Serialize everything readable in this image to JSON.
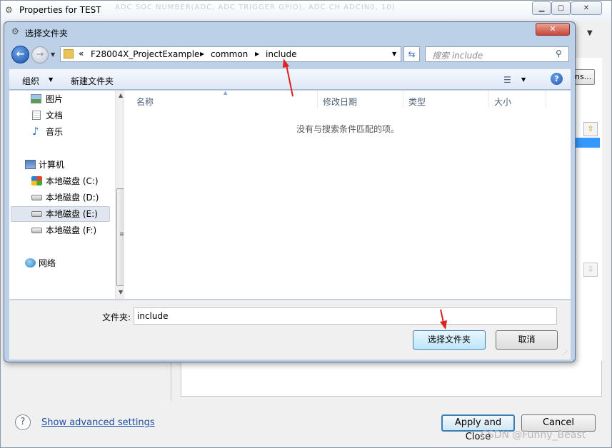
{
  "properties_window": {
    "title": "Properties for TEST",
    "faint_background_text": "ADC  SOC  NUMBER(ADC, ADC TRIGGER GPIO), ADC  CH  ADCIN0, 10)",
    "partial_button": "ns...",
    "help_glyph": "?",
    "advanced_link": "Show advanced settings",
    "apply_button": "Apply and Close",
    "cancel_button": "Cancel",
    "watermark": "CSDN @Funny_Beast"
  },
  "dialog": {
    "title": "选择文件夹",
    "close_glyph": "✕",
    "breadcrumb": {
      "overflow": "«",
      "items": [
        "F28004X_ProjectExample",
        "common",
        "include"
      ]
    },
    "search_placeholder": "搜索 include",
    "toolbar": {
      "organize": "组织",
      "new_folder": "新建文件夹"
    },
    "nav_pane": {
      "items": [
        {
          "label": "图片",
          "icon": "pictures-icon"
        },
        {
          "label": "文档",
          "icon": "documents-icon"
        },
        {
          "label": "音乐",
          "icon": "music-icon"
        },
        {
          "label": "计算机",
          "icon": "computer-icon"
        },
        {
          "label": "本地磁盘 (C:)",
          "icon": "system-drive-icon"
        },
        {
          "label": "本地磁盘 (D:)",
          "icon": "drive-icon"
        },
        {
          "label": "本地磁盘 (E:)",
          "icon": "drive-icon",
          "selected": true
        },
        {
          "label": "本地磁盘 (F:)",
          "icon": "drive-icon"
        },
        {
          "label": "网络",
          "icon": "network-icon"
        }
      ]
    },
    "columns": [
      "名称",
      "修改日期",
      "类型",
      "大小"
    ],
    "empty_message": "没有与搜索条件匹配的项。",
    "folder_label": "文件夹:",
    "folder_value": "include",
    "select_button": "选择文件夹",
    "cancel_button": "取消"
  },
  "colors": {
    "annotation_arrow": "#e02020",
    "link": "#1a4fa8",
    "selection": "#3399ff"
  }
}
